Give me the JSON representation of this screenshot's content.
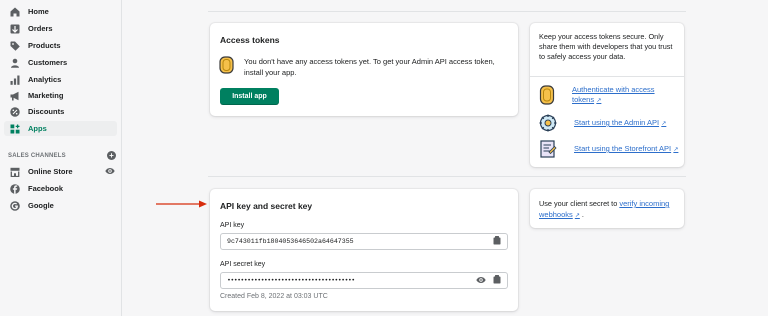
{
  "sidebar": {
    "items": [
      {
        "label": "Home",
        "icon": "home-icon"
      },
      {
        "label": "Orders",
        "icon": "orders-icon"
      },
      {
        "label": "Products",
        "icon": "tag-icon"
      },
      {
        "label": "Customers",
        "icon": "person-icon"
      },
      {
        "label": "Analytics",
        "icon": "analytics-icon"
      },
      {
        "label": "Marketing",
        "icon": "megaphone-icon"
      },
      {
        "label": "Discounts",
        "icon": "discount-icon"
      },
      {
        "label": "Apps",
        "icon": "apps-icon",
        "active": true
      }
    ],
    "sales_channels_label": "SALES CHANNELS",
    "channels": [
      {
        "label": "Online Store",
        "icon": "store-icon"
      },
      {
        "label": "Facebook",
        "icon": "facebook-icon"
      },
      {
        "label": "Google",
        "icon": "google-icon"
      }
    ]
  },
  "access_tokens": {
    "title": "Access tokens",
    "message": "You don't have any access tokens yet. To get your Admin API access token, install your app.",
    "install_button": "Install app"
  },
  "tips": {
    "text": "Keep your access tokens secure. Only share them with developers that you trust to safely access your data.",
    "links": [
      {
        "label": "Authenticate with access tokens",
        "icon": "token-icon"
      },
      {
        "label": "Start using the Admin API",
        "icon": "gear-cluster-icon"
      },
      {
        "label": "Start using the Storefront API",
        "icon": "storefront-doc-icon"
      }
    ]
  },
  "api_keys": {
    "title": "API key and secret key",
    "api_key_label": "API key",
    "api_key_value": "9c743011fb1804053646502a64647355",
    "secret_label": "API secret key",
    "secret_value": "••••••••••••••••••••••••••••••••••••••",
    "created": "Created Feb 8, 2022 at 03:03 UTC"
  },
  "webhook_tip": {
    "prefix": "Use your client secret to ",
    "link": "verify incoming webhooks",
    "suffix": " ."
  },
  "colors": {
    "accent": "#008060",
    "link": "#2c6ecb",
    "arrow": "#d72c0d"
  }
}
